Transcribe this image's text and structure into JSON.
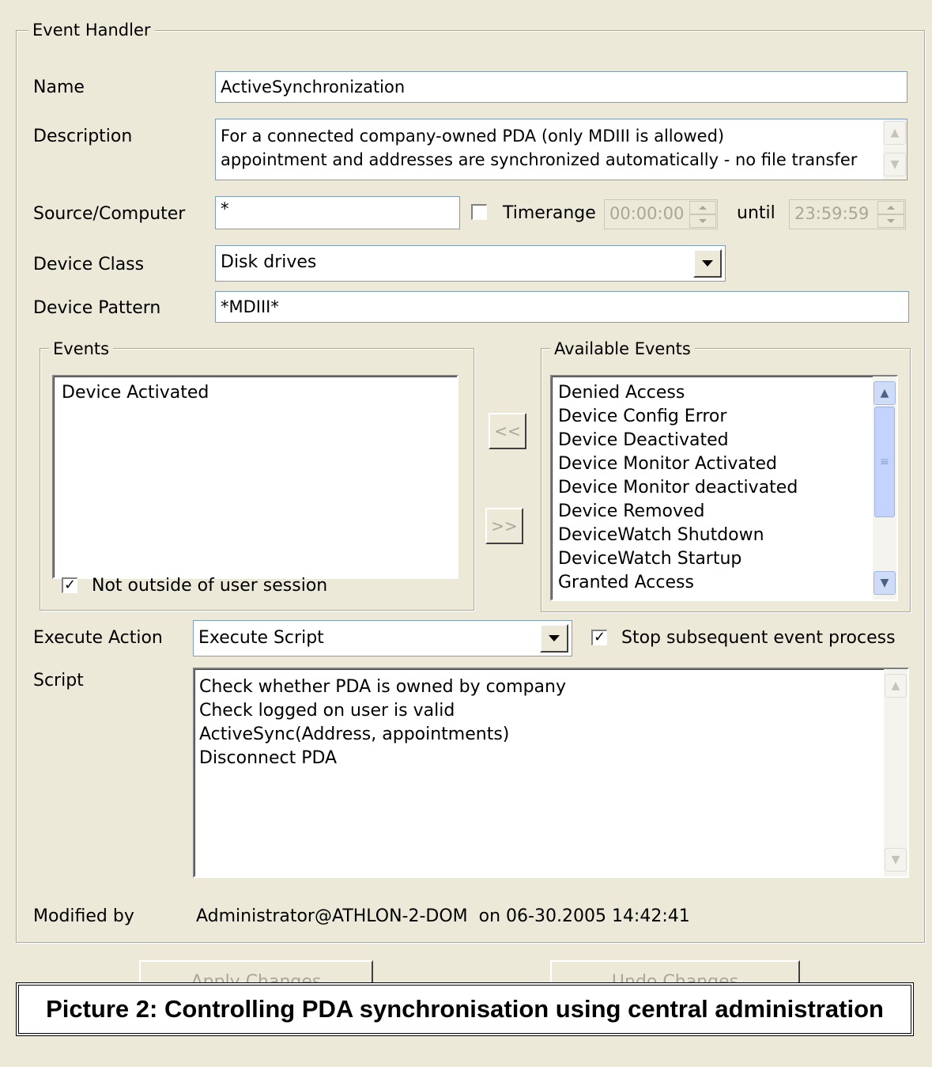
{
  "event_handler": {
    "title": "Event Handler",
    "name_label": "Name",
    "name_value": "ActiveSynchronization",
    "description_label": "Description",
    "description_lines": [
      "For a connected company-owned PDA (only MDIII is allowed)",
      "appointment and addresses are synchronized automatically - no file transfer"
    ],
    "source_label": "Source/Computer",
    "source_value": "*",
    "timerange_label": "Timerange",
    "timerange_checked": false,
    "time_from": "00:00:00",
    "until_label": "until",
    "time_to": "23:59:59",
    "device_class_label": "Device Class",
    "device_class_value": "Disk drives",
    "device_pattern_label": "Device Pattern",
    "device_pattern_value": "*MDIII*"
  },
  "events": {
    "title": "Events",
    "items": [
      "Device Activated"
    ],
    "not_outside_label": "Not outside of user session",
    "not_outside_checked": true
  },
  "transfer": {
    "add_label": "<<",
    "remove_label": ">>"
  },
  "available_events": {
    "title": "Available Events",
    "items": [
      "Denied Access",
      "Device Config Error",
      "Device Deactivated",
      "Device Monitor Activated",
      "Device Monitor deactivated",
      "Device Removed",
      "DeviceWatch Shutdown",
      "DeviceWatch Startup",
      "Granted Access"
    ]
  },
  "action": {
    "execute_label": "Execute Action",
    "execute_value": "Execute Script",
    "stop_label": "Stop subsequent event process",
    "stop_checked": true,
    "script_label": "Script",
    "script_lines": [
      "Check whether PDA is owned by company",
      "Check logged on user is valid",
      "ActiveSync(Address, appointments)",
      "Disconnect PDA"
    ]
  },
  "modified": {
    "label": "Modified by",
    "value": "Administrator@ATHLON-2-DOM  on 06-30.2005 14:42:41"
  },
  "buttons": {
    "apply": "Apply Changes",
    "undo": "Undo Changes"
  },
  "caption": "Picture 2: Controlling PDA synchronisation using central administration"
}
